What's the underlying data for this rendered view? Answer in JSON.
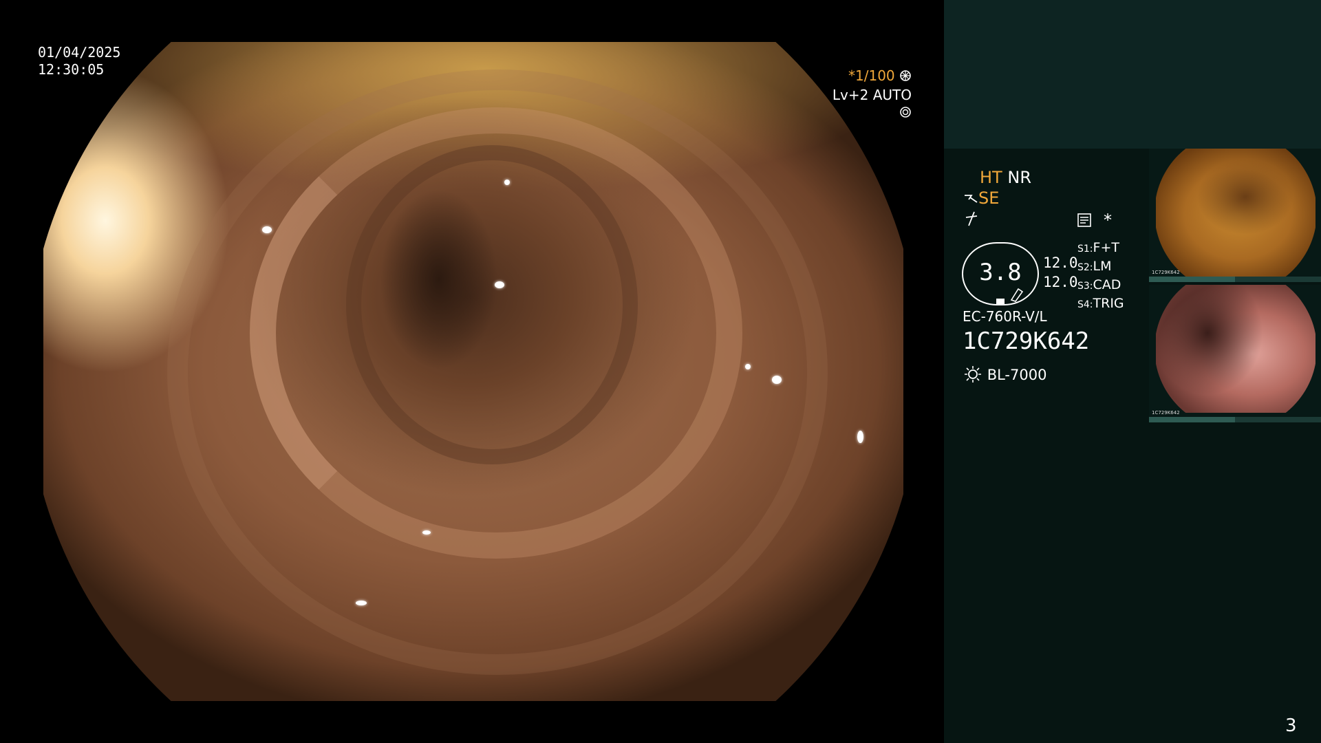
{
  "overlay": {
    "date": "01/04/2025",
    "time": "12:30:05",
    "shutter_prefix": "*",
    "shutter_value": "1/100",
    "level_label": "Lv+2",
    "exposure_mode": "AUTO"
  },
  "panel": {
    "mode_ht": "HT",
    "mode_nr": "NR",
    "mode_se": "SE",
    "asterisk": "*",
    "ring_value": "3.8",
    "values": [
      "12.0",
      "12.0"
    ],
    "switches": [
      {
        "key": "S1:",
        "value": "F+T"
      },
      {
        "key": "S2:",
        "value": "LM"
      },
      {
        "key": "S3:",
        "value": "CAD"
      },
      {
        "key": "S4:",
        "value": "TRIG"
      }
    ],
    "scope_model": "EC-760R-V/L",
    "serial": "1C729K642",
    "light_source": "BL-7000"
  },
  "thumbnails": [
    {
      "caption": "1C729K642"
    },
    {
      "caption": "1C729K642"
    }
  ],
  "page_number": "3",
  "colors": {
    "accent": "#f1a83a",
    "panel_bg": "#061512",
    "panel_header_bg": "#0d2422"
  },
  "icons": [
    "settings-icon",
    "aperture-icon",
    "scope-tip-icon",
    "lightning-icon",
    "document-icon",
    "sun-icon",
    "pencil-icon"
  ]
}
